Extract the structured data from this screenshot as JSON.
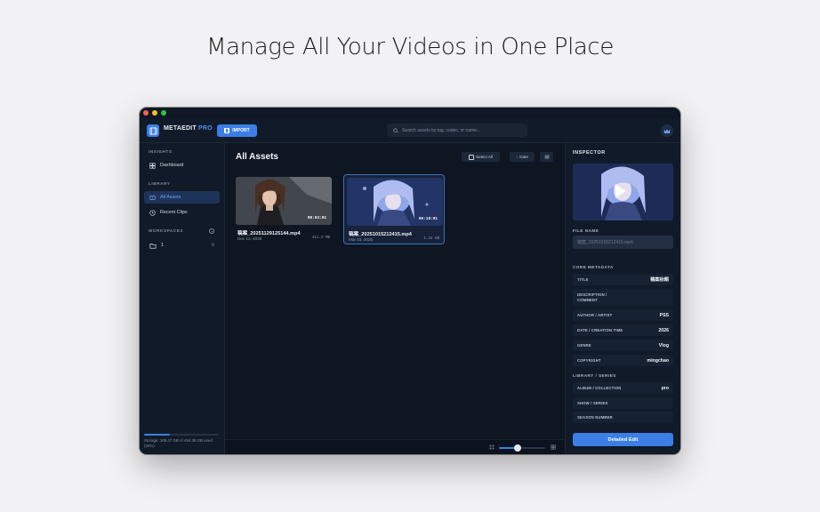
{
  "hero": {
    "title": "Manage All Your Videos in One Place"
  },
  "app": {
    "name": "METAEDIT",
    "name_suffix": "PRO"
  },
  "toolbar": {
    "import_label": "IMPORT",
    "search_placeholder": "Search assets by tag, codec, or name...",
    "avatar_icon": "crown-icon"
  },
  "sidebar": {
    "insights_label": "INSIGHTS",
    "dashboard_label": "Dashboard",
    "library_label": "LIBRARY",
    "all_assets_label": "All Assets",
    "recent_clips_label": "Recent Clips",
    "workspaces_label": "WORKSPACES",
    "workspace": {
      "name": "1",
      "count": "0"
    },
    "storage": {
      "text": "Storage: 169.47 GB of 494.38 GB used (34%)",
      "used_fraction": 0.34
    }
  },
  "main": {
    "title": "All Assets",
    "select_all_label": "Select All",
    "sort_label": "Date",
    "zoom_level": 0.4,
    "assets": [
      {
        "name": "稿案_20251129125144.mp4",
        "date": "Dec 13, 2025",
        "size": "411.9 MB",
        "duration": "00:03:01",
        "selected": false
      },
      {
        "name": "稿案_20251015212415.mp4",
        "date": "Mar 03, 2026",
        "size": "1.34 GB",
        "duration": "00:10:01",
        "selected": true
      }
    ]
  },
  "inspector": {
    "title": "INSPECTOR",
    "file_name_label": "FILE NAME",
    "file_name_value": "稿案_20251015212415.mp4",
    "core_metadata_label": "CORE METADATA",
    "core_fields": [
      {
        "key": "TITLE",
        "value": "稿案标题"
      },
      {
        "key": "DESCRIPTION / COMMENT",
        "value": ""
      },
      {
        "key": "AUTHOR / ARTIST",
        "value": "PSS"
      },
      {
        "key": "DATE / CREATION TIME",
        "value": "2026"
      },
      {
        "key": "GENRE",
        "value": "Vlog"
      },
      {
        "key": "COPYRIGHT",
        "value": "mingchao"
      }
    ],
    "library_series_label": "LIBRARY / SERIES",
    "library_fields": [
      {
        "key": "ALBUM / COLLECTION",
        "value": "pro"
      },
      {
        "key": "SHOW / SERIES",
        "value": ""
      },
      {
        "key": "SEASON NUMBER",
        "value": ""
      }
    ],
    "detailed_edit_label": "Detailed Edit"
  },
  "colors": {
    "accent": "#3b7ee6",
    "window_bg": "#0f1724",
    "panel_bg": "#111a28"
  }
}
